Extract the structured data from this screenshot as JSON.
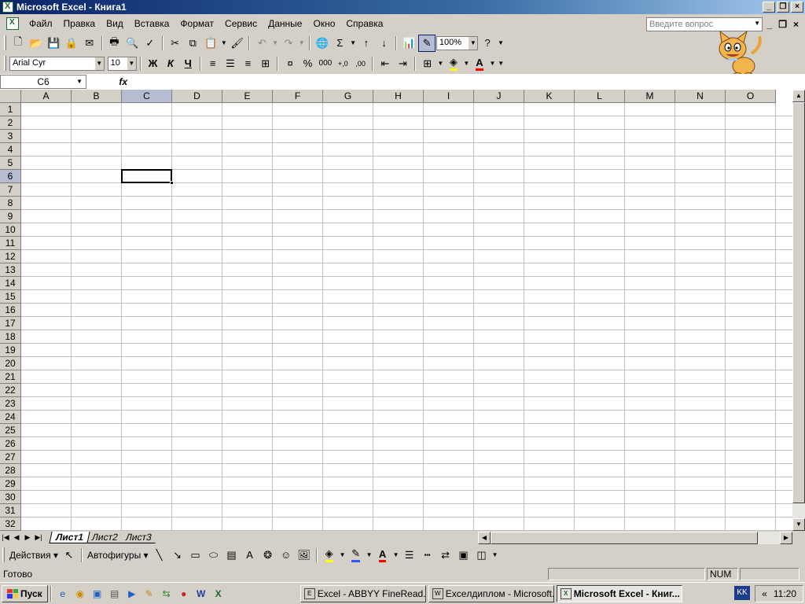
{
  "window": {
    "title": "Microsoft Excel - Книга1"
  },
  "menu": {
    "items": [
      "Файл",
      "Правка",
      "Вид",
      "Вставка",
      "Формат",
      "Сервис",
      "Данные",
      "Окно",
      "Справка"
    ],
    "ask_placeholder": "Введите вопрос"
  },
  "toolbar": {
    "zoom": "100%",
    "font_name": "Arial Cyr",
    "font_size": "10",
    "bold": "Ж",
    "italic": "К",
    "underline": "Ч",
    "thousands": "000",
    "percent": "%",
    "sum": "Σ",
    "fill_color": "#ffff00",
    "font_color": "#ff0000"
  },
  "formula_bar": {
    "name_box": "C6",
    "fx_label": "fx",
    "formula": ""
  },
  "grid": {
    "columns": [
      "A",
      "B",
      "C",
      "D",
      "E",
      "F",
      "G",
      "H",
      "I",
      "J",
      "K",
      "L",
      "M",
      "N",
      "O"
    ],
    "rows": [
      "1",
      "2",
      "3",
      "4",
      "5",
      "6",
      "7",
      "8",
      "9",
      "10",
      "11",
      "12",
      "13",
      "14",
      "15",
      "16",
      "17",
      "18",
      "19",
      "20",
      "21",
      "22",
      "23",
      "24",
      "25",
      "26",
      "27",
      "28",
      "29",
      "30",
      "31",
      "32"
    ],
    "active_column": "C",
    "active_row": "6"
  },
  "sheets": {
    "tabs": [
      "Лист1",
      "Лист2",
      "Лист3"
    ],
    "active": "Лист1"
  },
  "drawing": {
    "actions_label": "Действия",
    "autoshapes_label": "Автофигуры"
  },
  "status": {
    "text": "Готово",
    "num": "NUM"
  },
  "taskbar": {
    "start_label": "Пуск",
    "buttons": [
      "Excel - ABBYY FineRead...",
      "Exceлдиплом - Microsoft...",
      "Microsoft Excel - Книг..."
    ],
    "lang": "KK",
    "tray_arrows": "«",
    "clock": "11:20"
  }
}
